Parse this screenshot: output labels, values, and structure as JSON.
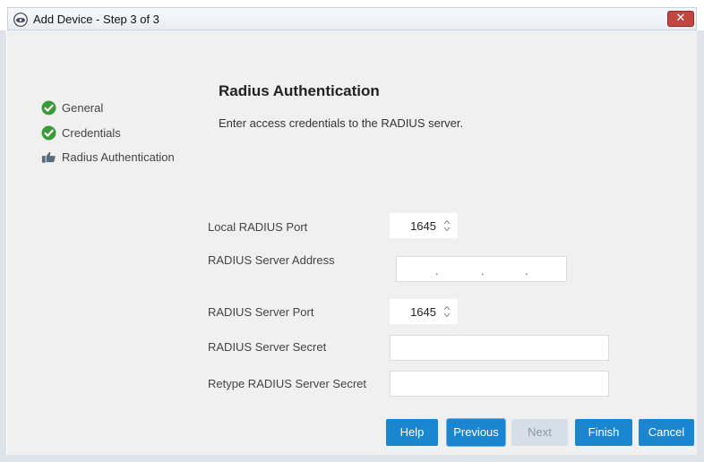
{
  "window": {
    "title": "Add Device - Step 3 of 3",
    "close_label": "✕"
  },
  "steps": [
    {
      "label": "General",
      "state": "done",
      "icon": "check-circle-icon"
    },
    {
      "label": "Credentials",
      "state": "done",
      "icon": "check-circle-icon"
    },
    {
      "label": "Radius Authentication",
      "state": "current",
      "icon": "thumbs-up-icon"
    }
  ],
  "section": {
    "heading": "Radius Authentication",
    "description": "Enter access credentials to the RADIUS server."
  },
  "fields": {
    "local_port": {
      "label": "Local RADIUS Port",
      "value": "1645"
    },
    "server_address": {
      "label": "RADIUS Server Address",
      "value": ""
    },
    "server_port": {
      "label": "RADIUS Server Port",
      "value": "1645"
    },
    "server_secret": {
      "label": "RADIUS Server Secret",
      "value": ""
    },
    "retype_secret": {
      "label": "Retype RADIUS Server Secret",
      "value": ""
    }
  },
  "buttons": {
    "help": "Help",
    "previous": "Previous",
    "next": "Next",
    "finish": "Finish",
    "cancel": "Cancel"
  },
  "colors": {
    "primary_button": "#1a86d0",
    "disabled_button": "#d6dfe7",
    "check_green": "#3a9b3a",
    "close_red": "#c0463f"
  }
}
